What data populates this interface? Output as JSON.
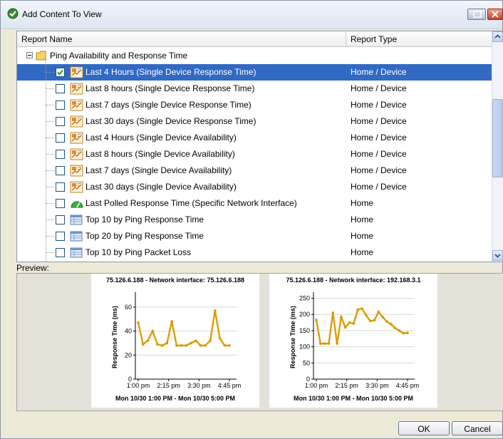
{
  "window": {
    "title": "Add Content To View"
  },
  "table": {
    "columns": [
      "Report Name",
      "Report Type"
    ],
    "folder": "Ping Availability and Response Time",
    "rows": [
      {
        "name": "Last 4 Hours (Single Device Response Time)",
        "type": "Home / Device",
        "checked": true,
        "selected": true,
        "icon": "report-icon"
      },
      {
        "name": "Last 8 hours (Single Device Response Time)",
        "type": "Home / Device",
        "checked": false,
        "selected": false,
        "icon": "report-icon"
      },
      {
        "name": "Last 7 days (Single Device Response Time)",
        "type": "Home / Device",
        "checked": false,
        "selected": false,
        "icon": "report-icon"
      },
      {
        "name": "Last 30 days (Single Device Response Time)",
        "type": "Home / Device",
        "checked": false,
        "selected": false,
        "icon": "report-icon"
      },
      {
        "name": "Last 4 Hours (Single Device Availability)",
        "type": "Home / Device",
        "checked": false,
        "selected": false,
        "icon": "report-icon"
      },
      {
        "name": "Last 8 hours (Single Device Availability)",
        "type": "Home / Device",
        "checked": false,
        "selected": false,
        "icon": "report-icon"
      },
      {
        "name": "Last 7 days (Single Device Availability)",
        "type": "Home / Device",
        "checked": false,
        "selected": false,
        "icon": "report-icon"
      },
      {
        "name": "Last 30 days (Single Device Availability)",
        "type": "Home / Device",
        "checked": false,
        "selected": false,
        "icon": "report-icon"
      },
      {
        "name": "Last Polled Response Time (Specific Network Interface)",
        "type": "Home",
        "checked": false,
        "selected": false,
        "icon": "gauge-icon"
      },
      {
        "name": "Top 10 by Ping Response Time",
        "type": "Home",
        "checked": false,
        "selected": false,
        "icon": "table-icon"
      },
      {
        "name": "Top 20 by Ping Response Time",
        "type": "Home",
        "checked": false,
        "selected": false,
        "icon": "table-icon"
      },
      {
        "name": "Top 10 by Ping Packet Loss",
        "type": "Home",
        "checked": false,
        "selected": false,
        "icon": "table-icon"
      }
    ]
  },
  "preview": {
    "label": "Preview:"
  },
  "buttons": {
    "ok": "OK",
    "cancel": "Cancel"
  },
  "colors": {
    "selection": "#316ac5",
    "series": "#d99a00"
  },
  "chart_data": [
    {
      "type": "line",
      "title": "75.126.6.188 - Network interface: 75.126.6.188",
      "subtitle": "Mon 10/30 1:00 PM - Mon 10/30 5:00 PM",
      "ylabel": "Response Time (ms)",
      "xlabel": "",
      "yticks": [
        0,
        20,
        40,
        60
      ],
      "ylim": [
        0,
        70
      ],
      "xticks": [
        "1:00 pm",
        "2:15 pm",
        "3:30 pm",
        "4:45 pm"
      ],
      "x": [
        0,
        1,
        2,
        3,
        4,
        5,
        6,
        7,
        8,
        9,
        10,
        11,
        12,
        13,
        14,
        15,
        16,
        17,
        18,
        19
      ],
      "values": [
        47,
        29,
        32,
        40,
        29,
        28,
        30,
        48,
        28,
        28,
        28,
        30,
        32,
        28,
        28,
        32,
        57,
        34,
        28,
        28
      ],
      "grid": true
    },
    {
      "type": "line",
      "title": "75.126.6.188 - Network interface: 192.168.3.1",
      "subtitle": "Mon 10/30 1:00 PM - Mon 10/30 5:00 PM",
      "ylabel": "Response Time (ms)",
      "xlabel": "",
      "yticks": [
        0,
        50,
        100,
        150,
        200,
        250
      ],
      "ylim": [
        0,
        260
      ],
      "xticks": [
        "1:00 pm",
        "2:15 pm",
        "3:30 pm",
        "4:45 pm"
      ],
      "x": [
        0,
        1,
        2,
        3,
        4,
        5,
        6,
        7,
        8,
        9,
        10,
        11,
        12,
        13,
        14,
        15,
        16,
        17,
        18,
        19,
        20,
        21,
        22
      ],
      "values": [
        183,
        110,
        110,
        110,
        205,
        110,
        192,
        160,
        175,
        172,
        215,
        218,
        198,
        180,
        182,
        208,
        192,
        178,
        170,
        158,
        150,
        142,
        143
      ],
      "grid": true
    }
  ]
}
